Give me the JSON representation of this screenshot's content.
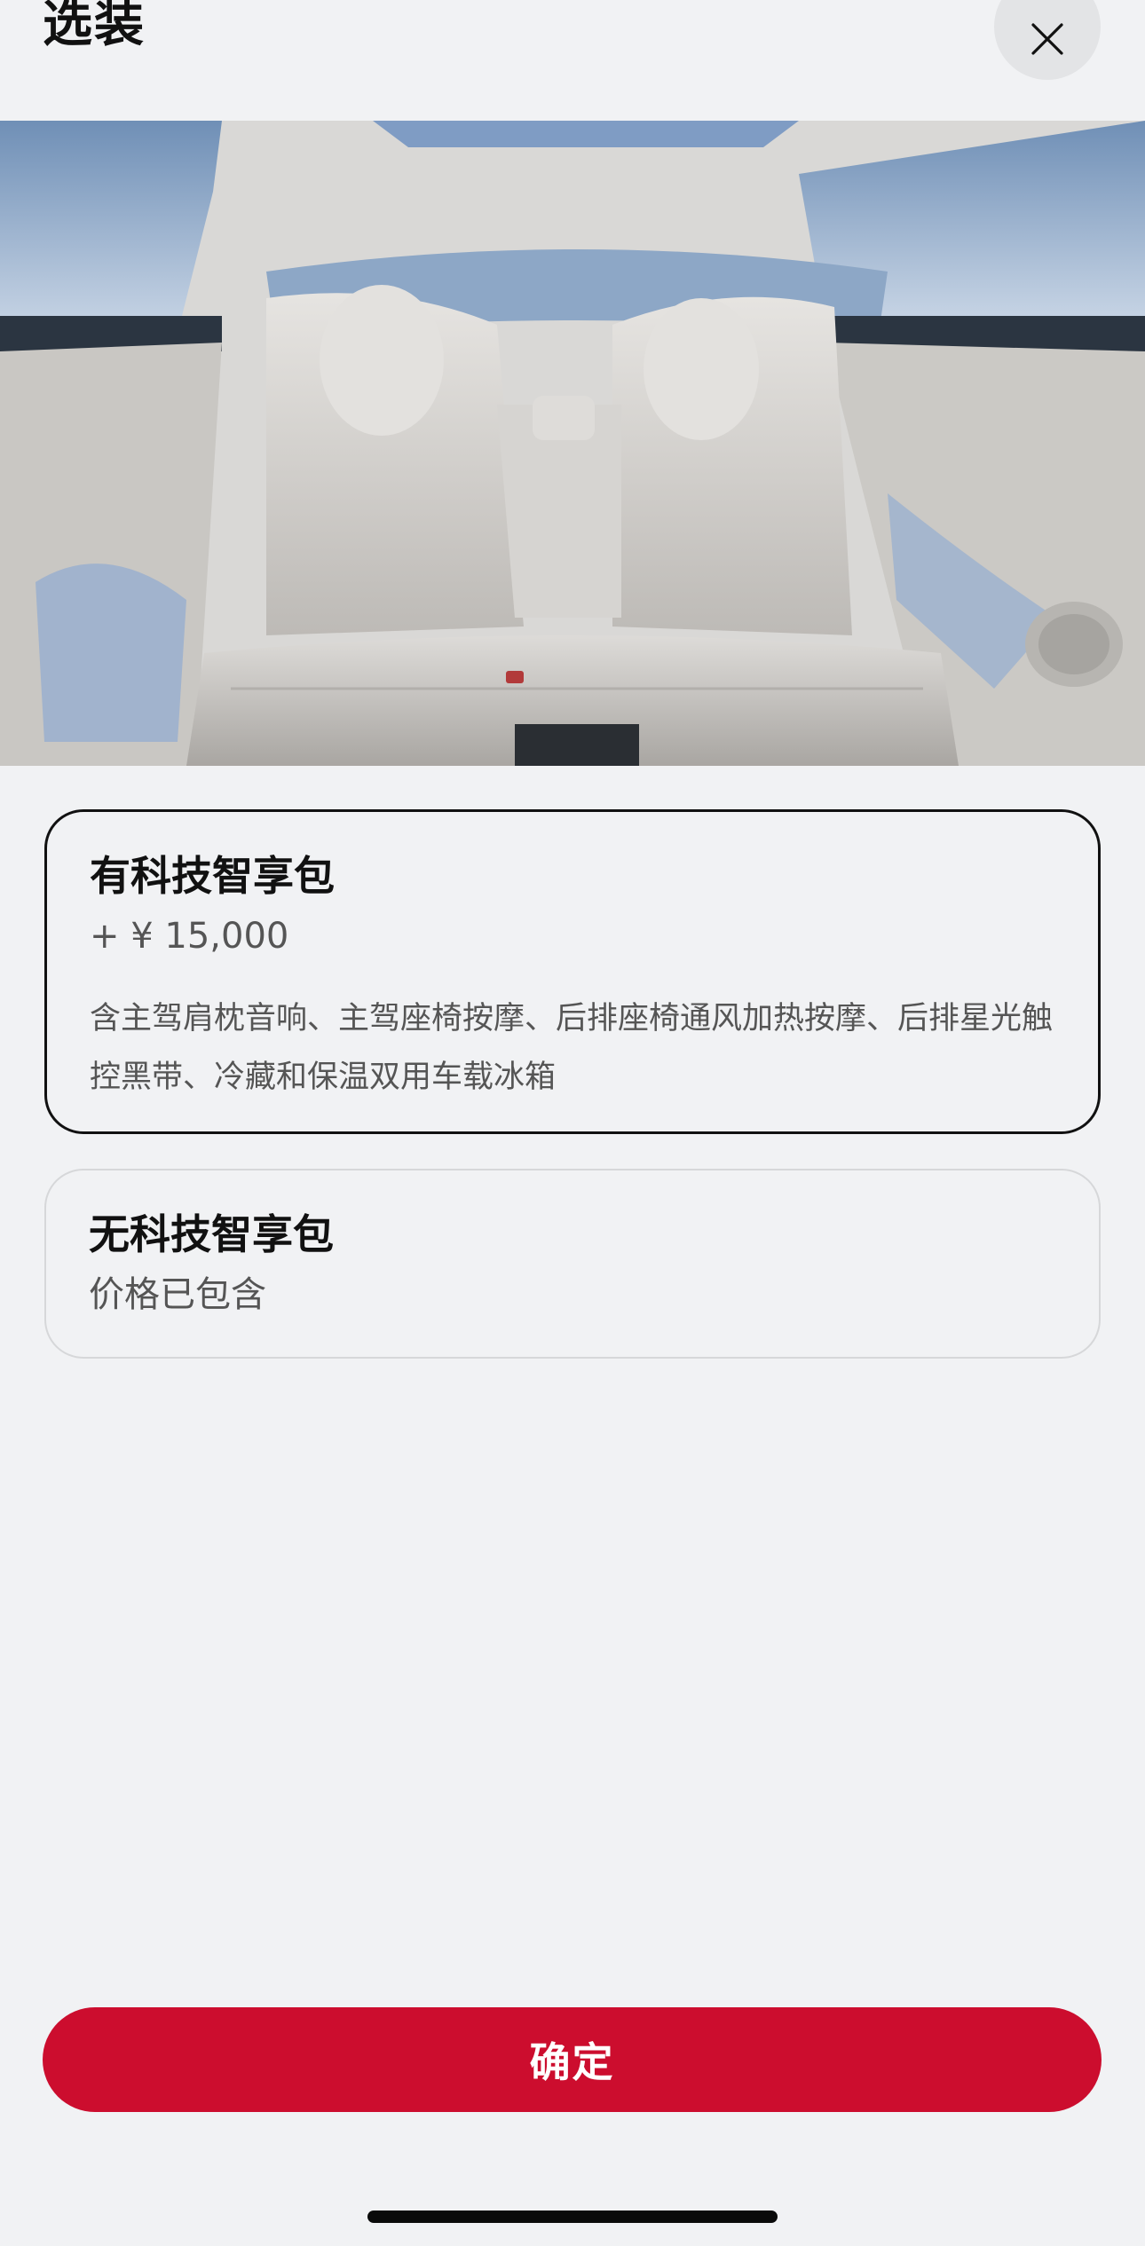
{
  "header": {
    "title": "选装"
  },
  "hero": {
    "image_name": "car-rear-seat-interior"
  },
  "options": [
    {
      "title": "有科技智享包",
      "price": "+ ¥ 15,000",
      "description": "含主驾肩枕音响、主驾座椅按摩、后排座椅通风加热按摩、后排星光触控黑带、冷藏和保温双用车载冰箱",
      "selected": true
    },
    {
      "title": "无科技智享包",
      "price": "价格已包含",
      "selected": false
    }
  ],
  "footer": {
    "confirm_label": "确定"
  },
  "colors": {
    "accent": "#cc0d2e",
    "background": "#f1f2f4"
  }
}
